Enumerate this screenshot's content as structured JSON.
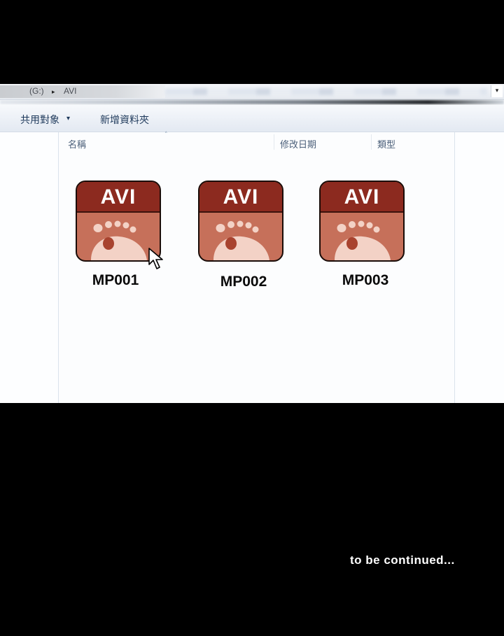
{
  "address": {
    "drive": "(G:)",
    "separator": "▸",
    "folder": "AVI",
    "dropdown": "▾"
  },
  "toolbar": {
    "share_label": "共用對象",
    "share_caret": "▾",
    "newfolder_label": "新增資料夾"
  },
  "columns": {
    "name": "名稱",
    "date": "修改日期",
    "type": "類型",
    "sort_indicator": "˄"
  },
  "files": [
    {
      "badge": "AVI",
      "name": "MP001",
      "icon": "video-file-icon"
    },
    {
      "badge": "AVI",
      "name": "MP002",
      "icon": "video-file-icon"
    },
    {
      "badge": "AVI",
      "name": "MP003",
      "icon": "video-file-icon"
    }
  ],
  "caption": "to be continued...",
  "colors": {
    "badge_band": "#8c2a1f",
    "badge_body": "#c6705a",
    "footprint": "#f3d2c6",
    "background": "#000000"
  }
}
